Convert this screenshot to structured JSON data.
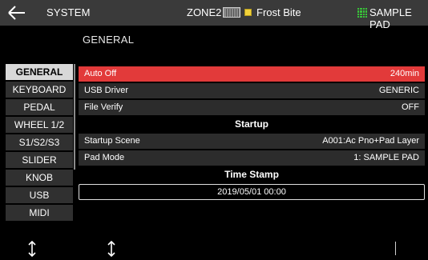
{
  "header": {
    "title": "SYSTEM",
    "zone": "ZONE2",
    "scene_name": "Frost Bite",
    "pad_mode_label": "SAMPLE PAD",
    "icons": [
      "back-arrow-icon",
      "keyboard-icon",
      "scene-square-icon",
      "pad-grid-icon"
    ]
  },
  "page": {
    "title": "GENERAL"
  },
  "nav": {
    "items": [
      {
        "label": "GENERAL",
        "active": true
      },
      {
        "label": "KEYBOARD",
        "active": false
      },
      {
        "label": "PEDAL",
        "active": false
      },
      {
        "label": "WHEEL 1/2",
        "active": false
      },
      {
        "label": "S1/S2/S3",
        "active": false
      },
      {
        "label": "SLIDER",
        "active": false
      },
      {
        "label": "KNOB",
        "active": false
      },
      {
        "label": "USB",
        "active": false
      },
      {
        "label": "MIDI",
        "active": false
      }
    ]
  },
  "params": {
    "auto_off": {
      "label": "Auto Off",
      "value": "240min"
    },
    "usb_driver": {
      "label": "USB Driver",
      "value": "GENERIC"
    },
    "file_verify": {
      "label": "File Verify",
      "value": "OFF"
    },
    "startup_heading": "Startup",
    "startup_scene": {
      "label": "Startup Scene",
      "value": "A001:Ac Pno+Pad Layer"
    },
    "pad_mode": {
      "label": "Pad Mode",
      "value": "1: SAMPLE PAD"
    },
    "timestamp_heading": "Time Stamp",
    "timestamp_value": "2019/05/01   00:00"
  },
  "footer": {
    "icons": [
      "up-down-arrow-icon",
      "up-down-arrow-icon"
    ]
  },
  "colors": {
    "selected_row": "#e23a3a",
    "active_tab": "#d8d8d8",
    "pad_icon": "#39c239",
    "scene_square": "#f2d23a"
  }
}
